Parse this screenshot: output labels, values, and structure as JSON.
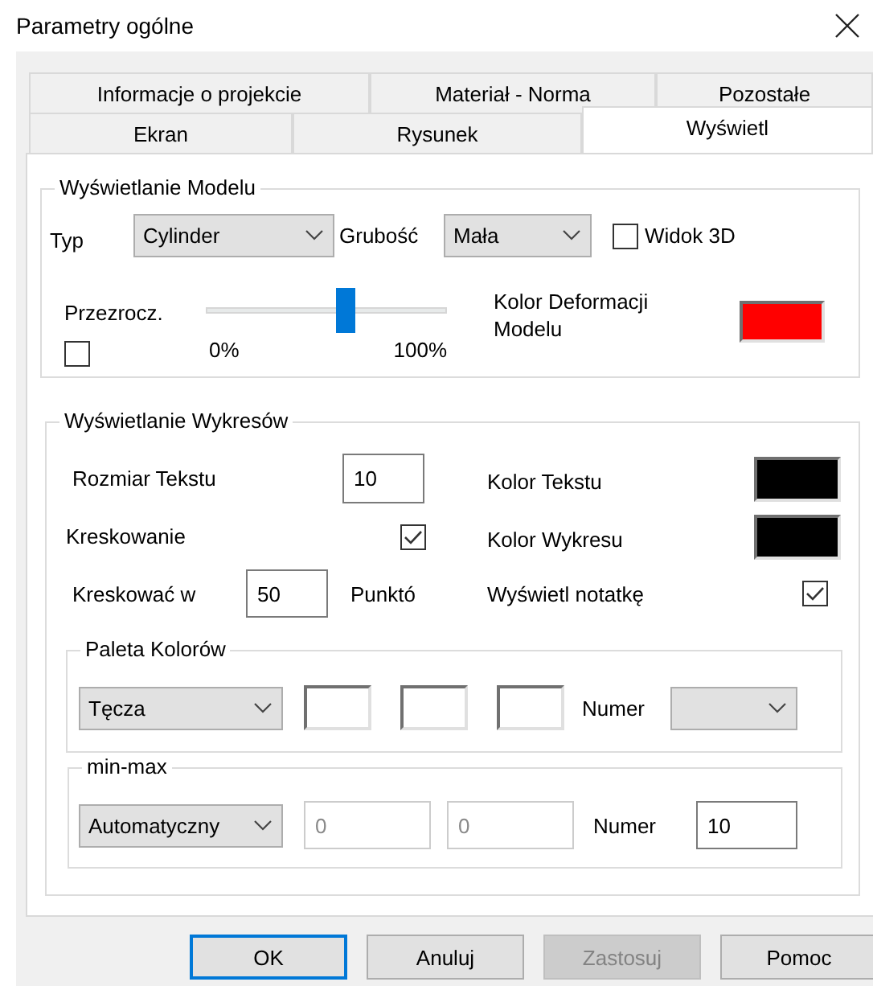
{
  "window": {
    "title": "Parametry ogólne"
  },
  "tab_rows": [
    {
      "tabs": [
        {
          "label": "Informacje o projekcie",
          "selected": false
        },
        {
          "label": "Materiał - Norma",
          "selected": false
        },
        {
          "label": "Pozostałe",
          "selected": false
        }
      ]
    },
    {
      "tabs": [
        {
          "label": "Ekran",
          "selected": false
        },
        {
          "label": "Rysunek",
          "selected": false
        },
        {
          "label": "Wyświetl",
          "selected": true
        }
      ]
    }
  ],
  "model_display": {
    "title": "Wyświetlanie Modelu",
    "type_label": "Typ",
    "type_value": "Cylinder",
    "thickness_label": "Grubość",
    "thickness_value": "Mała",
    "view3d": {
      "label": "Widok 3D",
      "checked": false
    },
    "transparency": {
      "label": "Przezrocz.",
      "checked": false,
      "level": 0.58,
      "min_label": "0%",
      "max_label": "100%"
    },
    "deformation_color": {
      "label": "Kolor Deformacji Modelu",
      "color": "#ff0000"
    }
  },
  "chart_display": {
    "title": "Wyświetlanie Wykresów",
    "text_size": {
      "label": "Rozmiar Tekstu",
      "value": "10"
    },
    "text_color": {
      "label": "Kolor Tekstu",
      "color": "#000000"
    },
    "hatching": {
      "label": "Kreskowanie",
      "checked": true
    },
    "chart_color": {
      "label": "Kolor Wykresu",
      "color": "#000000"
    },
    "hatch_every": {
      "label": "Kreskować w",
      "value": "50",
      "unit": "Punktó"
    },
    "show_note": {
      "label": "Wyświetl notatkę",
      "checked": true
    },
    "palette": {
      "title": "Paleta Kolorów",
      "scheme": "Tęcza",
      "swatches": [
        {
          "color": "#ffffff"
        },
        {
          "color": "#ffffff"
        },
        {
          "color": "#ffffff"
        }
      ],
      "number_label": "Numer"
    },
    "min_max": {
      "title": "min-max",
      "mode": "Automatyczny",
      "min": {
        "value": "0",
        "disabled": true
      },
      "max": {
        "value": "0",
        "disabled": true
      },
      "number_label": "Numer",
      "number_value": "10"
    }
  },
  "buttons": [
    {
      "label": "OK",
      "default": true,
      "disabled": false
    },
    {
      "label": "Anuluj",
      "default": false,
      "disabled": false
    },
    {
      "label": "Zastosuj",
      "default": false,
      "disabled": true
    },
    {
      "label": "Pomoc",
      "default": false,
      "disabled": false
    }
  ]
}
